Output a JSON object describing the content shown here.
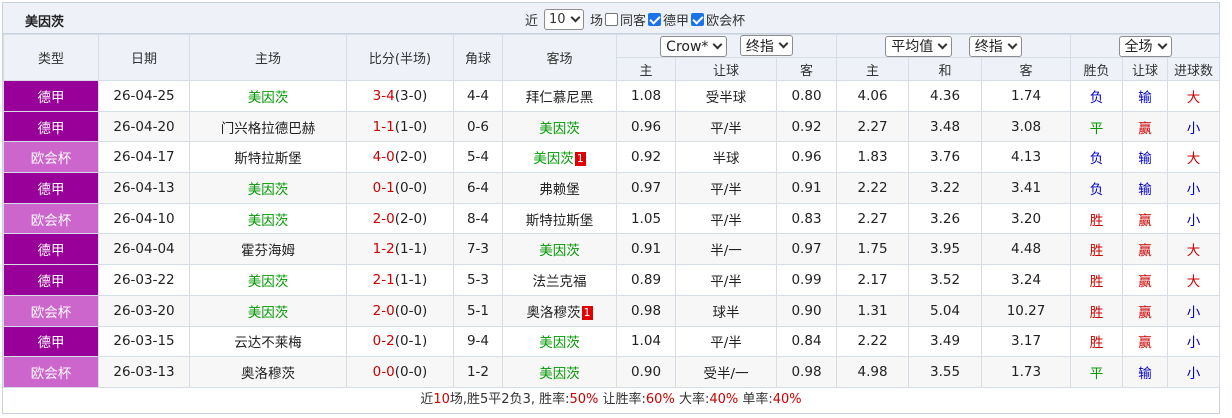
{
  "title": "美因茨",
  "controls": {
    "prefix": "近",
    "count": "10",
    "suffix": "场",
    "options": [
      {
        "label": "同客",
        "checked": false
      },
      {
        "label": "德甲",
        "checked": true
      },
      {
        "label": "欧会杯",
        "checked": true
      }
    ]
  },
  "headers": {
    "type": "类型",
    "date": "日期",
    "home": "主场",
    "score": "比分(半场)",
    "corner": "角球",
    "away": "客场",
    "company": "Crow*",
    "handicap_mode": "终指",
    "avg": "平均值",
    "euro_mode": "终指",
    "scope": "全场",
    "sub": {
      "h_home": "主",
      "h_line": "让球",
      "h_away": "客",
      "e_home": "主",
      "e_draw": "和",
      "e_away": "客"
    },
    "wdl": "胜负",
    "hcap_result": "让球",
    "goals": "进球数"
  },
  "rows": [
    {
      "league": "德甲",
      "league_class": "dejia",
      "date": "26-04-25",
      "home": "美因茨",
      "home_hl": true,
      "score": "3-4",
      "half": "(3-0)",
      "corner": "4-4",
      "away": "拜仁慕尼黑",
      "away_hl": false,
      "away_badge": "",
      "h_home": "1.08",
      "h_line": "受半球",
      "h_away": "0.80",
      "e_home": "4.06",
      "e_draw": "4.36",
      "e_away": "1.74",
      "wdl": "负",
      "wdl_c": "blue",
      "hr": "输",
      "hr_c": "blue",
      "goals": "大",
      "goals_c": "red"
    },
    {
      "league": "德甲",
      "league_class": "dejia",
      "date": "26-04-20",
      "home": "门兴格拉德巴赫",
      "home_hl": false,
      "score": "1-1",
      "half": "(1-0)",
      "corner": "0-6",
      "away": "美因茨",
      "away_hl": true,
      "away_badge": "",
      "h_home": "0.96",
      "h_line": "平/半",
      "h_away": "0.92",
      "e_home": "2.27",
      "e_draw": "3.48",
      "e_away": "3.08",
      "wdl": "平",
      "wdl_c": "green",
      "hr": "赢",
      "hr_c": "red",
      "goals": "小",
      "goals_c": "blue"
    },
    {
      "league": "欧会杯",
      "league_class": "ohb",
      "date": "26-04-17",
      "home": "斯特拉斯堡",
      "home_hl": false,
      "score": "4-0",
      "half": "(2-0)",
      "corner": "5-4",
      "away": "美因茨",
      "away_hl": true,
      "away_badge": "1",
      "h_home": "0.92",
      "h_line": "半球",
      "h_away": "0.96",
      "e_home": "1.83",
      "e_draw": "3.76",
      "e_away": "4.13",
      "wdl": "负",
      "wdl_c": "blue",
      "hr": "输",
      "hr_c": "blue",
      "goals": "大",
      "goals_c": "red"
    },
    {
      "league": "德甲",
      "league_class": "dejia",
      "date": "26-04-13",
      "home": "美因茨",
      "home_hl": true,
      "score": "0-1",
      "half": "(0-0)",
      "corner": "6-4",
      "away": "弗赖堡",
      "away_hl": false,
      "away_badge": "",
      "h_home": "0.97",
      "h_line": "平/半",
      "h_away": "0.91",
      "e_home": "2.22",
      "e_draw": "3.22",
      "e_away": "3.41",
      "wdl": "负",
      "wdl_c": "blue",
      "hr": "输",
      "hr_c": "blue",
      "goals": "小",
      "goals_c": "blue"
    },
    {
      "league": "欧会杯",
      "league_class": "ohb",
      "date": "26-04-10",
      "home": "美因茨",
      "home_hl": true,
      "score": "2-0",
      "half": "(2-0)",
      "corner": "8-4",
      "away": "斯特拉斯堡",
      "away_hl": false,
      "away_badge": "",
      "h_home": "1.05",
      "h_line": "平/半",
      "h_away": "0.83",
      "e_home": "2.27",
      "e_draw": "3.26",
      "e_away": "3.20",
      "wdl": "胜",
      "wdl_c": "red",
      "hr": "赢",
      "hr_c": "red",
      "goals": "小",
      "goals_c": "blue"
    },
    {
      "league": "德甲",
      "league_class": "dejia",
      "date": "26-04-04",
      "home": "霍芬海姆",
      "home_hl": false,
      "score": "1-2",
      "half": "(1-1)",
      "corner": "7-3",
      "away": "美因茨",
      "away_hl": true,
      "away_badge": "",
      "h_home": "0.91",
      "h_line": "半/一",
      "h_away": "0.97",
      "e_home": "1.75",
      "e_draw": "3.95",
      "e_away": "4.48",
      "wdl": "胜",
      "wdl_c": "red",
      "hr": "赢",
      "hr_c": "red",
      "goals": "大",
      "goals_c": "red"
    },
    {
      "league": "德甲",
      "league_class": "dejia",
      "date": "26-03-22",
      "home": "美因茨",
      "home_hl": true,
      "score": "2-1",
      "half": "(1-1)",
      "corner": "5-3",
      "away": "法兰克福",
      "away_hl": false,
      "away_badge": "",
      "h_home": "0.89",
      "h_line": "平/半",
      "h_away": "0.99",
      "e_home": "2.17",
      "e_draw": "3.52",
      "e_away": "3.24",
      "wdl": "胜",
      "wdl_c": "red",
      "hr": "赢",
      "hr_c": "red",
      "goals": "大",
      "goals_c": "red"
    },
    {
      "league": "欧会杯",
      "league_class": "ohb",
      "date": "26-03-20",
      "home": "美因茨",
      "home_hl": true,
      "score": "2-0",
      "half": "(0-0)",
      "corner": "5-1",
      "away": "奥洛穆茨",
      "away_hl": false,
      "away_badge": "1",
      "h_home": "0.98",
      "h_line": "球半",
      "h_away": "0.90",
      "e_home": "1.31",
      "e_draw": "5.04",
      "e_away": "10.27",
      "wdl": "胜",
      "wdl_c": "red",
      "hr": "赢",
      "hr_c": "red",
      "goals": "小",
      "goals_c": "blue"
    },
    {
      "league": "德甲",
      "league_class": "dejia",
      "date": "26-03-15",
      "home": "云达不莱梅",
      "home_hl": false,
      "score": "0-2",
      "half": "(0-1)",
      "corner": "9-4",
      "away": "美因茨",
      "away_hl": true,
      "away_badge": "",
      "h_home": "1.04",
      "h_line": "平/半",
      "h_away": "0.84",
      "e_home": "2.22",
      "e_draw": "3.49",
      "e_away": "3.17",
      "wdl": "胜",
      "wdl_c": "red",
      "hr": "赢",
      "hr_c": "red",
      "goals": "小",
      "goals_c": "blue"
    },
    {
      "league": "欧会杯",
      "league_class": "ohb",
      "date": "26-03-13",
      "home": "奥洛穆茨",
      "home_hl": false,
      "score": "0-0",
      "half": "(0-0)",
      "corner": "1-2",
      "away": "美因茨",
      "away_hl": true,
      "away_badge": "",
      "h_home": "0.90",
      "h_line": "受半/一",
      "h_away": "0.98",
      "e_home": "4.98",
      "e_draw": "3.55",
      "e_away": "1.73",
      "wdl": "平",
      "wdl_c": "green",
      "hr": "输",
      "hr_c": "blue",
      "goals": "小",
      "goals_c": "blue"
    }
  ],
  "summary": {
    "t1": "近",
    "n": "10",
    "t2": "场,胜5平2负3, 胜率:",
    "win_rate": "50%",
    "t3": " 让胜率:",
    "hcap_rate": "60%",
    "t4": " 大率:",
    "big_rate": "40%",
    "t5": " 单率:",
    "odd_rate": "40%"
  }
}
